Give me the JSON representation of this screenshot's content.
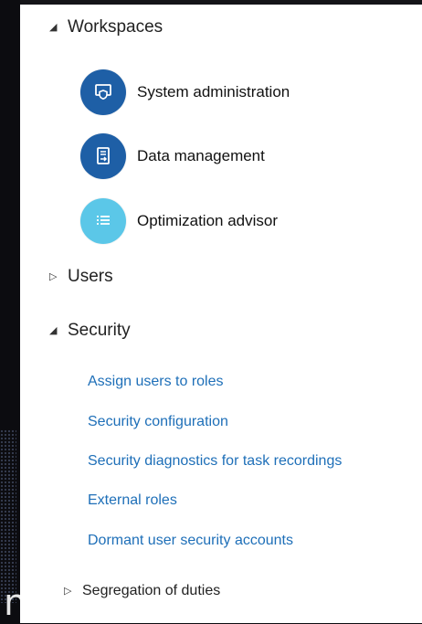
{
  "colors": {
    "accent_dark": "#1e5fa6",
    "accent_light": "#5bc7e8",
    "link": "#1e6fb8"
  },
  "sections": {
    "workspaces": {
      "label": "Workspaces",
      "expanded": true,
      "items": [
        {
          "label": "System administration",
          "icon": "shield-monitor-icon",
          "color": "#1e5fa6"
        },
        {
          "label": "Data management",
          "icon": "document-transfer-icon",
          "color": "#1e5fa6"
        },
        {
          "label": "Optimization advisor",
          "icon": "checklist-icon",
          "color": "#5bc7e8"
        }
      ]
    },
    "users": {
      "label": "Users",
      "expanded": false
    },
    "security": {
      "label": "Security",
      "expanded": true,
      "links": [
        "Assign users to roles",
        "Security configuration",
        "Security diagnostics for task recordings",
        "External roles",
        "Dormant user security accounts"
      ],
      "subsection": {
        "label": "Segregation of duties",
        "expanded": false
      }
    }
  },
  "edge_text": "n"
}
